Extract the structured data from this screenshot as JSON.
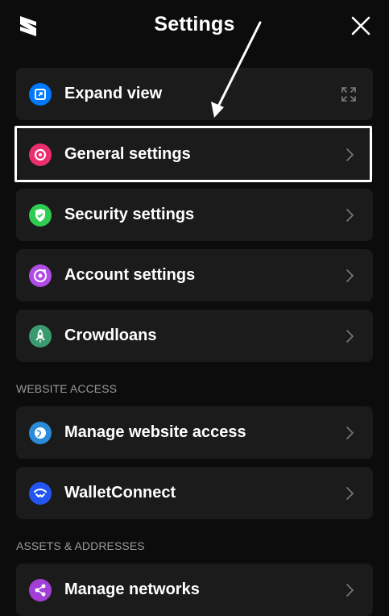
{
  "header": {
    "title": "Settings",
    "logo_icon": "subwallet-logo-icon",
    "close_icon": "close-icon"
  },
  "items": [
    {
      "label": "Expand view",
      "icon": "expand-view-icon",
      "color": "#0078ff",
      "trailing": "fullscreen-icon"
    },
    {
      "label": "General settings",
      "icon": "settings-icon",
      "color": "#eb2f6e",
      "trailing": "chevron-right-icon"
    },
    {
      "label": "Security settings",
      "icon": "shield-check-icon",
      "color": "#2ecc51",
      "trailing": "chevron-right-icon"
    },
    {
      "label": "Account settings",
      "icon": "user-gear-icon",
      "color": "#b04ce6",
      "trailing": "chevron-right-icon"
    },
    {
      "label": "Crowdloans",
      "icon": "rocket-icon",
      "color": "#3a9b6e",
      "trailing": "chevron-right-icon"
    },
    {
      "label": "Manage website access",
      "icon": "globe-icon",
      "color": "#2b8ad9",
      "trailing": "chevron-right-icon"
    },
    {
      "label": "WalletConnect",
      "icon": "walletconnect-icon",
      "color": "#2356f0",
      "trailing": "chevron-right-icon"
    },
    {
      "label": "Manage networks",
      "icon": "share-network-icon",
      "color": "#a13fd6",
      "trailing": "chevron-right-icon"
    }
  ],
  "sections": {
    "website_access": "WEBSITE ACCESS",
    "assets_addresses": "ASSETS & ADDRESSES"
  },
  "annotation": {
    "highlight_target": "General settings",
    "arrow_color": "#ffffff"
  }
}
